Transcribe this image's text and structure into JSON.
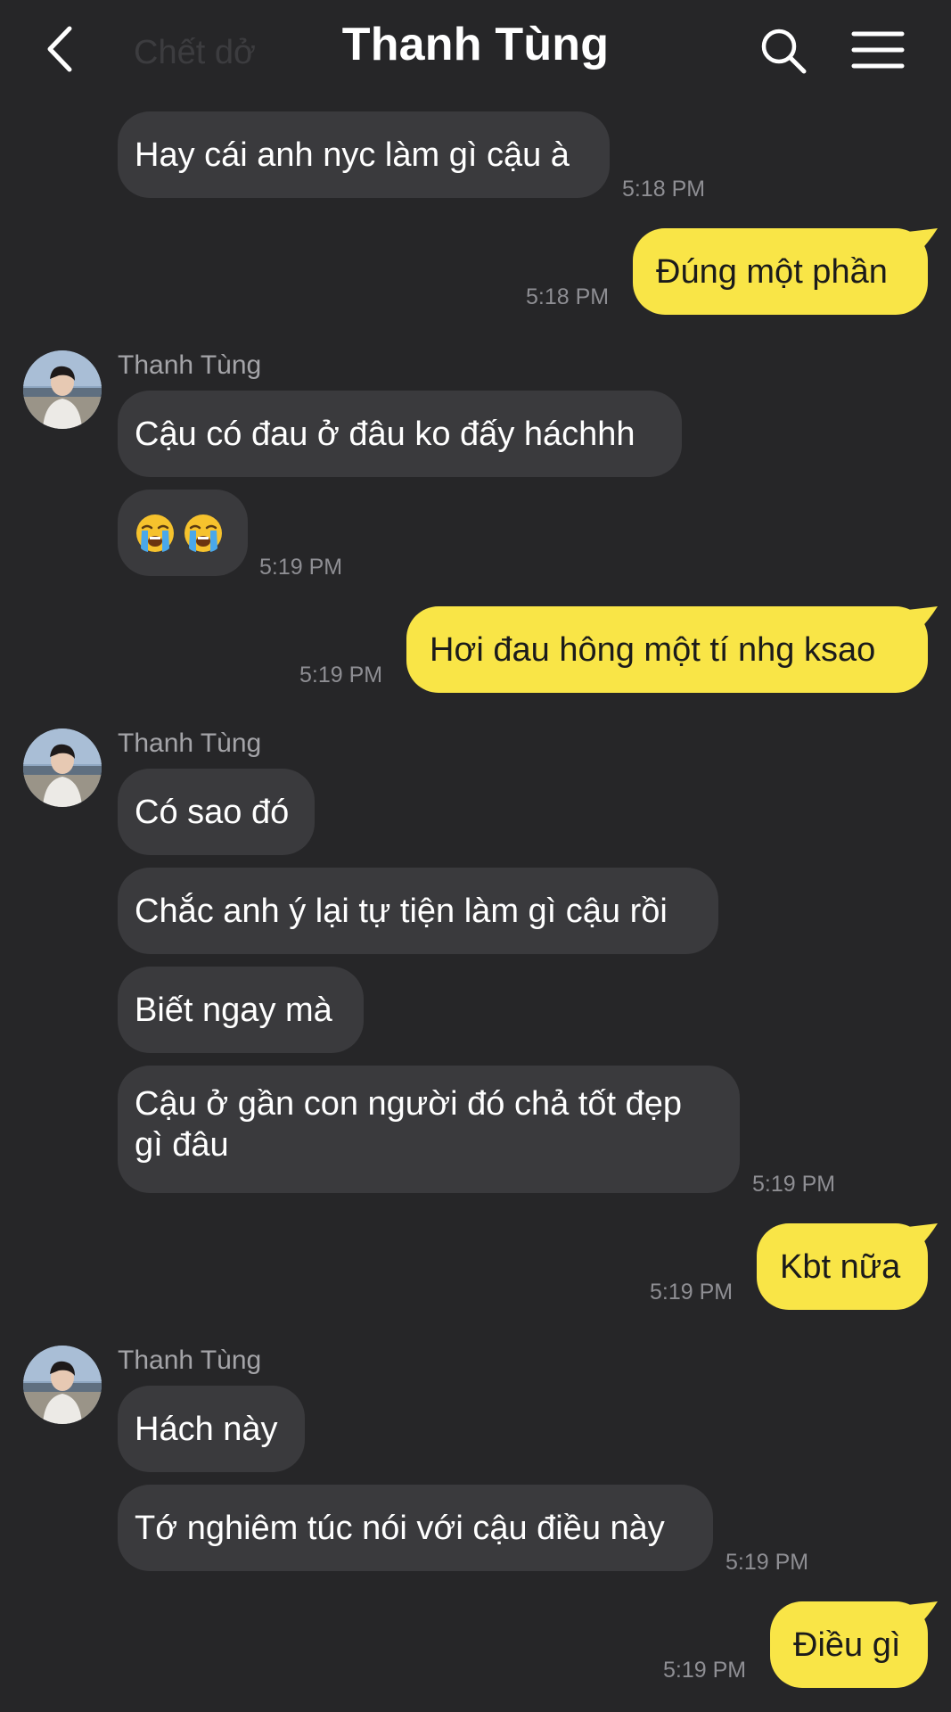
{
  "header": {
    "title": "Thanh Tùng",
    "ghost_text": "Chết dở",
    "back_icon": "chevron-left-icon",
    "search_icon": "search-icon",
    "menu_icon": "menu-icon"
  },
  "colors": {
    "background": "#262628",
    "incoming_bubble": "#3a3a3d",
    "outgoing_bubble": "#f9e547",
    "timestamp": "#8e8e93"
  },
  "messages": {
    "m1": {
      "text": "Hay cái anh nyc làm gì cậu à",
      "time": "5:18 PM"
    },
    "m2": {
      "text": "Đúng một phần",
      "time": "5:18 PM"
    },
    "g1": {
      "sender": "Thanh Tùng",
      "m3": {
        "text": "Cậu có đau ở đâu ko đấy háchhh"
      },
      "m4": {
        "emoji": [
          "loudly-crying-face-icon",
          "loudly-crying-face-icon"
        ],
        "time": "5:19 PM"
      }
    },
    "m5": {
      "text": "Hơi đau hông một tí nhg ksao",
      "time": "5:19 PM"
    },
    "g2": {
      "sender": "Thanh Tùng",
      "m6": {
        "text": "Có sao đó"
      },
      "m7": {
        "text": "Chắc anh ý lại tự tiện làm gì cậu rồi"
      },
      "m8": {
        "text": "Biết ngay mà"
      },
      "m9": {
        "text": "Cậu ở gần con người đó chả tốt đẹp gì đâu",
        "time": "5:19 PM"
      }
    },
    "m10": {
      "text": "Kbt nữa",
      "time": "5:19 PM"
    },
    "g3": {
      "sender": "Thanh Tùng",
      "m11": {
        "text": "Hách này"
      },
      "m12": {
        "text": "Tớ nghiêm túc nói với cậu điều này",
        "time": "5:19 PM"
      }
    },
    "m13": {
      "text": "Điều gì",
      "time": "5:19 PM"
    }
  }
}
